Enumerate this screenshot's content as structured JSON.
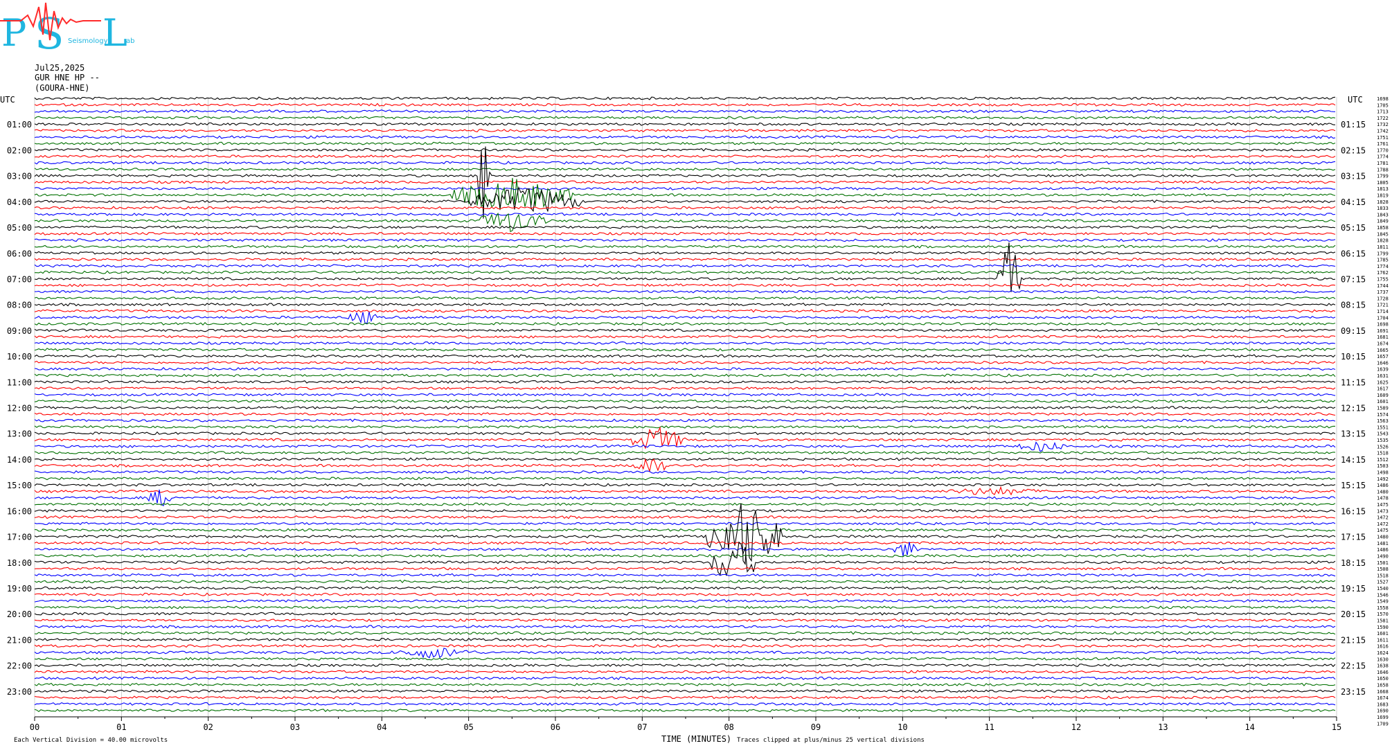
{
  "header": {
    "date": "Jul25,2025",
    "station": "GUR HNE HP --",
    "location": "(GOURA-HNE)"
  },
  "logo": {
    "letters": [
      "P",
      "S",
      "L"
    ],
    "small_text": [
      "Seismology",
      "ab"
    ],
    "colors": {
      "letters": "#1fb6e0",
      "trace": "#ff2a2a"
    }
  },
  "axes": {
    "left_title": "UTC",
    "right_title": "UTC",
    "left_hours": [
      "01:00",
      "02:00",
      "03:00",
      "04:00",
      "05:00",
      "06:00",
      "07:00",
      "08:00",
      "09:00",
      "10:00",
      "11:00",
      "12:00",
      "13:00",
      "14:00",
      "15:00",
      "16:00",
      "17:00",
      "18:00",
      "19:00",
      "20:00",
      "21:00",
      "22:00",
      "23:00"
    ],
    "right_hours": [
      "01:15",
      "02:15",
      "03:15",
      "04:15",
      "05:15",
      "06:15",
      "07:15",
      "08:15",
      "09:15",
      "10:15",
      "11:15",
      "12:15",
      "13:15",
      "14:15",
      "15:15",
      "16:15",
      "17:15",
      "18:15",
      "19:15",
      "20:15",
      "21:15",
      "22:15",
      "23:15"
    ],
    "x_ticks": [
      "00",
      "01",
      "02",
      "03",
      "04",
      "05",
      "06",
      "07",
      "08",
      "09",
      "10",
      "11",
      "12",
      "13",
      "14",
      "15"
    ],
    "x_label": "TIME (MINUTES)"
  },
  "footer": {
    "division_note": "Each Vertical Division =   40.00 microvolts",
    "clip_note": "Traces clipped at plus/minus 25 vertical divisions"
  },
  "right_values": [
    "1698",
    "1705",
    "1713",
    "1722",
    "1732",
    "1742",
    "1751",
    "1761",
    "1770",
    "1774",
    "1781",
    "1788",
    "1799",
    "1805",
    "1813",
    "1819",
    "1828",
    "1833",
    "1843",
    "1849",
    "1858",
    "1845",
    "1828",
    "1811",
    "1799",
    "1785",
    "1774",
    "1762",
    "1755",
    "1744",
    "1737",
    "1728",
    "1721",
    "1714",
    "1704",
    "1698",
    "1691",
    "1681",
    "1674",
    "1665",
    "1657",
    "1646",
    "1639",
    "1631",
    "1625",
    "1617",
    "1609",
    "1601",
    "1589",
    "1574",
    "1563",
    "1551",
    "1543",
    "1535",
    "1526",
    "1518",
    "1512",
    "1503",
    "1498",
    "1492",
    "1486",
    "1480",
    "1478",
    "1475",
    "1473",
    "1472",
    "1472",
    "1475",
    "1480",
    "1481",
    "1486",
    "1490",
    "1501",
    "1508",
    "1518",
    "1527",
    "1540",
    "1546",
    "1549",
    "1558",
    "1570",
    "1581",
    "1590",
    "1601",
    "1611",
    "1616",
    "1624",
    "1630",
    "1638",
    "1646",
    "1650",
    "1658",
    "1668",
    "1674",
    "1683",
    "1690",
    "1699",
    "1709"
  ],
  "chart_data": {
    "type": "line",
    "title": "",
    "xlabel": "TIME (MINUTES)",
    "ylabel": "UTC",
    "xlim": [
      0,
      15
    ],
    "traces_per_hour": 4,
    "total_traces": 96,
    "minutes_per_trace": 15,
    "trace_colors": [
      "#000000",
      "#ff0000",
      "#0000ff",
      "#007000"
    ],
    "grid": "vertical lines at each minute",
    "events": [
      {
        "trace": 12,
        "start_min": 5.1,
        "end_min": 5.25,
        "amp": 70,
        "color_index": 3,
        "kind": "spike"
      },
      {
        "trace": 15,
        "start_min": 4.8,
        "end_min": 6.2,
        "amp": 26,
        "color_index": 3,
        "kind": "burst"
      },
      {
        "trace": 16,
        "start_min": 5.0,
        "end_min": 6.3,
        "amp": 22,
        "color_index": 3,
        "kind": "burst"
      },
      {
        "trace": 19,
        "start_min": 5.1,
        "end_min": 5.9,
        "amp": 18,
        "color_index": 3,
        "kind": "burst"
      },
      {
        "trace": 28,
        "start_min": 11.1,
        "end_min": 11.35,
        "amp": 60,
        "color_index": 0,
        "kind": "spike"
      },
      {
        "trace": 34,
        "start_min": 3.6,
        "end_min": 3.95,
        "amp": 12,
        "color_index": 2,
        "kind": "burst"
      },
      {
        "trace": 53,
        "start_min": 6.85,
        "end_min": 7.5,
        "amp": 20,
        "color_index": 3,
        "kind": "burst"
      },
      {
        "trace": 57,
        "start_min": 6.9,
        "end_min": 7.3,
        "amp": 16,
        "color_index": 3,
        "kind": "burst"
      },
      {
        "trace": 68,
        "start_min": 7.75,
        "end_min": 8.6,
        "amp": 55,
        "color_index": 0,
        "kind": "burst"
      },
      {
        "trace": 72,
        "start_min": 7.8,
        "end_min": 8.3,
        "amp": 40,
        "color_index": 0,
        "kind": "burst"
      },
      {
        "trace": 70,
        "start_min": 9.9,
        "end_min": 10.2,
        "amp": 14,
        "color_index": 2,
        "kind": "burst"
      },
      {
        "trace": 61,
        "start_min": 10.5,
        "end_min": 11.6,
        "amp": 7,
        "color_index": 2,
        "kind": "burst"
      },
      {
        "trace": 54,
        "start_min": 11.3,
        "end_min": 11.9,
        "amp": 9,
        "color_index": 3,
        "kind": "burst"
      },
      {
        "trace": 62,
        "start_min": 1.3,
        "end_min": 1.6,
        "amp": 14,
        "color_index": 3,
        "kind": "burst"
      },
      {
        "trace": 86,
        "start_min": 4.1,
        "end_min": 5.1,
        "amp": 9,
        "color_index": 0,
        "kind": "burst"
      }
    ]
  }
}
